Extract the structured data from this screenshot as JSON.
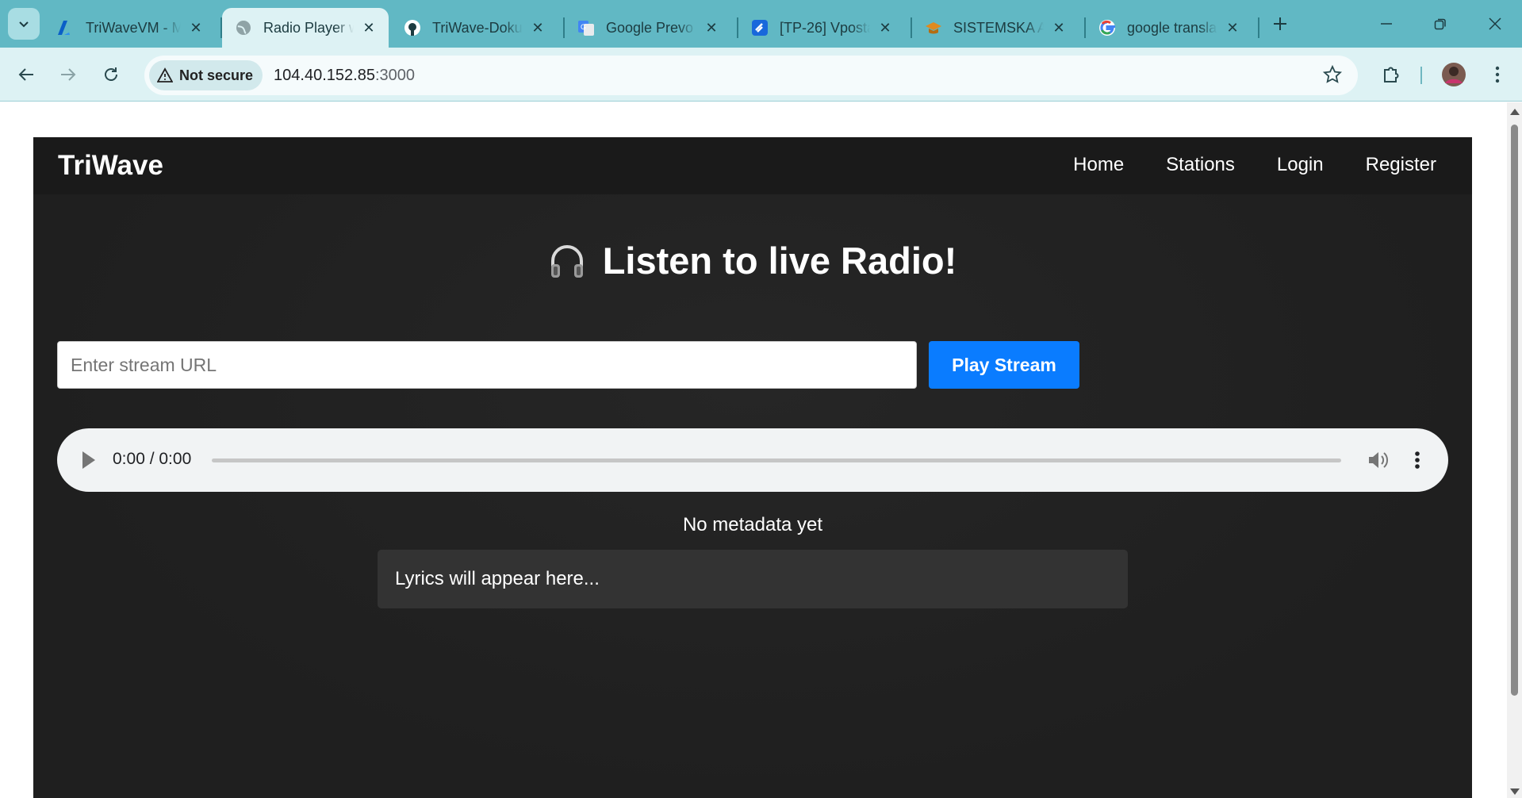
{
  "browser": {
    "tabs": [
      {
        "title": "TriWaveVM - M",
        "icon": "azure-icon",
        "active": false
      },
      {
        "title": "Radio Player w",
        "icon": "globe-icon",
        "active": true
      },
      {
        "title": "TriWave-Doku",
        "icon": "github-icon",
        "active": false
      },
      {
        "title": "Google Prevo",
        "icon": "google-translate-icon",
        "active": false
      },
      {
        "title": "[TP-26] Vposta",
        "icon": "jira-icon",
        "active": false
      },
      {
        "title": "SISTEMSKA AI",
        "icon": "graduation-cap-icon",
        "active": false
      },
      {
        "title": "google transla",
        "icon": "google-icon",
        "active": false
      }
    ],
    "security_label": "Not secure",
    "url_host": "104.40.152.85",
    "url_port": ":3000"
  },
  "app": {
    "brand": "TriWave",
    "nav": [
      "Home",
      "Stations",
      "Login",
      "Register"
    ],
    "heading_icon": "🎧",
    "heading": "Listen to live Radio!",
    "stream_placeholder": "Enter stream URL",
    "play_label": "Play Stream",
    "player": {
      "time": "0:00 / 0:00",
      "progress": 0
    },
    "metadata": "No metadata yet",
    "lyrics": "Lyrics will appear here..."
  },
  "colors": {
    "tabstrip": "#61b8c4",
    "toolbar": "#ddf2f4",
    "app_bg": "#1e1e1e",
    "navbar": "#1a1a1a",
    "accent": "#0a7cff",
    "lyrics_bg": "#333333"
  }
}
